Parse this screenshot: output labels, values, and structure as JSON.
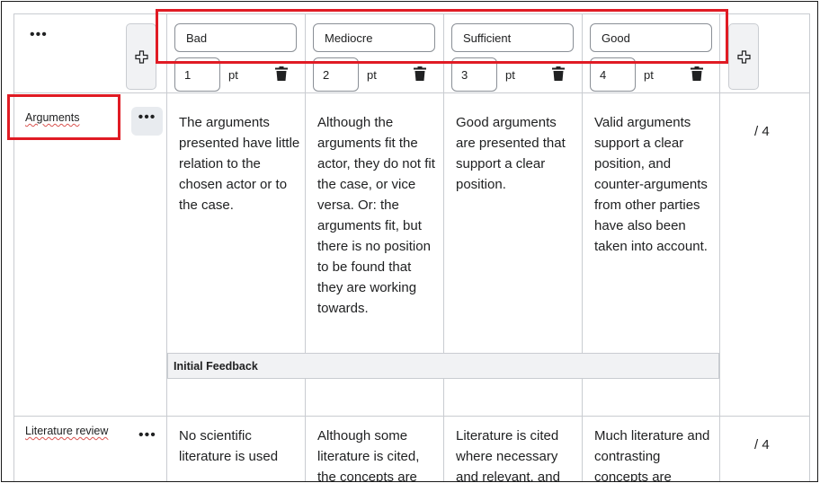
{
  "header": {
    "levels": [
      {
        "name": "Bad",
        "points": "1",
        "unit": "pt"
      },
      {
        "name": "Mediocre",
        "points": "2",
        "unit": "pt"
      },
      {
        "name": "Sufficient",
        "points": "3",
        "unit": "pt"
      },
      {
        "name": "Good",
        "points": "4",
        "unit": "pt"
      }
    ]
  },
  "criteria": [
    {
      "name": "Arguments",
      "descriptions": [
        "The arguments presented have little relation to the chosen actor or to the case.",
        "Although the arguments fit the actor, they do not fit the case, or vice versa. Or: the arguments fit, but there is no position to be found that they are working towards.",
        "Good arguments are presented that support a clear position.",
        "Valid arguments support a clear position, and counter-arguments from other parties have also been taken into account."
      ],
      "score": "/ 4",
      "feedback_label": "Initial Feedback"
    },
    {
      "name": "Literature review",
      "descriptions": [
        "No scientific literature is used",
        "Although some literature is cited, the concepts are",
        "Literature is cited where necessary and relevant, and",
        "Much literature and contrasting concepts are"
      ],
      "score": "/ 4"
    }
  ],
  "colors": {
    "highlight": "#e01b24",
    "border": "#c9ccd1",
    "button_bg": "#f1f2f4"
  },
  "icons": {
    "more": "more-dots-icon",
    "add": "plus-icon",
    "delete": "trash-icon"
  }
}
